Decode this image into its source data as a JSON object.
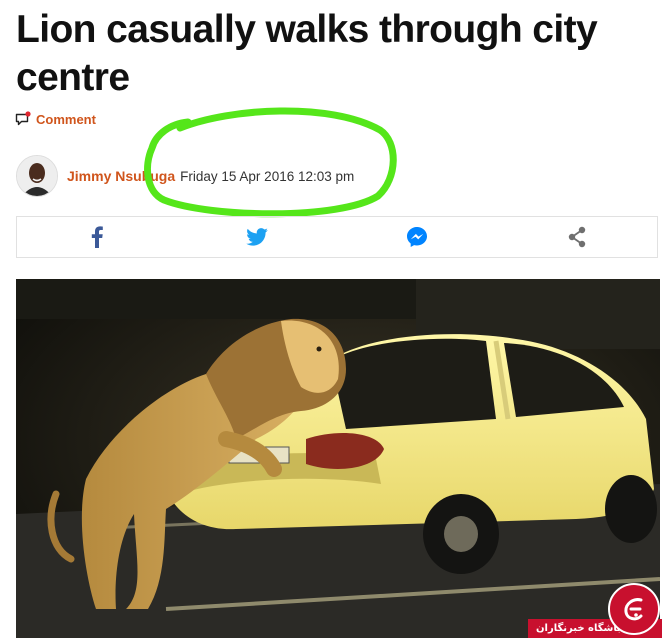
{
  "article": {
    "headline": "Lion casually walks through city centre",
    "comment_label": "Comment",
    "author": "Jimmy Nsubuga",
    "datetime": "Friday 15 Apr 2016 12:03 pm"
  },
  "share_bar": {
    "buttons": [
      {
        "icon": "facebook-icon",
        "color": "#3b5998"
      },
      {
        "icon": "twitter-icon",
        "color": "#1da1f2"
      },
      {
        "icon": "messenger-icon",
        "color": "#0084ff"
      },
      {
        "icon": "share-icon",
        "color": "#6f6f6f"
      }
    ]
  },
  "watermark": {
    "text": "باشگاه خبرنگاران"
  },
  "colors": {
    "accent": "#d0551c",
    "highlight": "#55e61a",
    "badge_red": "#c8102e"
  }
}
